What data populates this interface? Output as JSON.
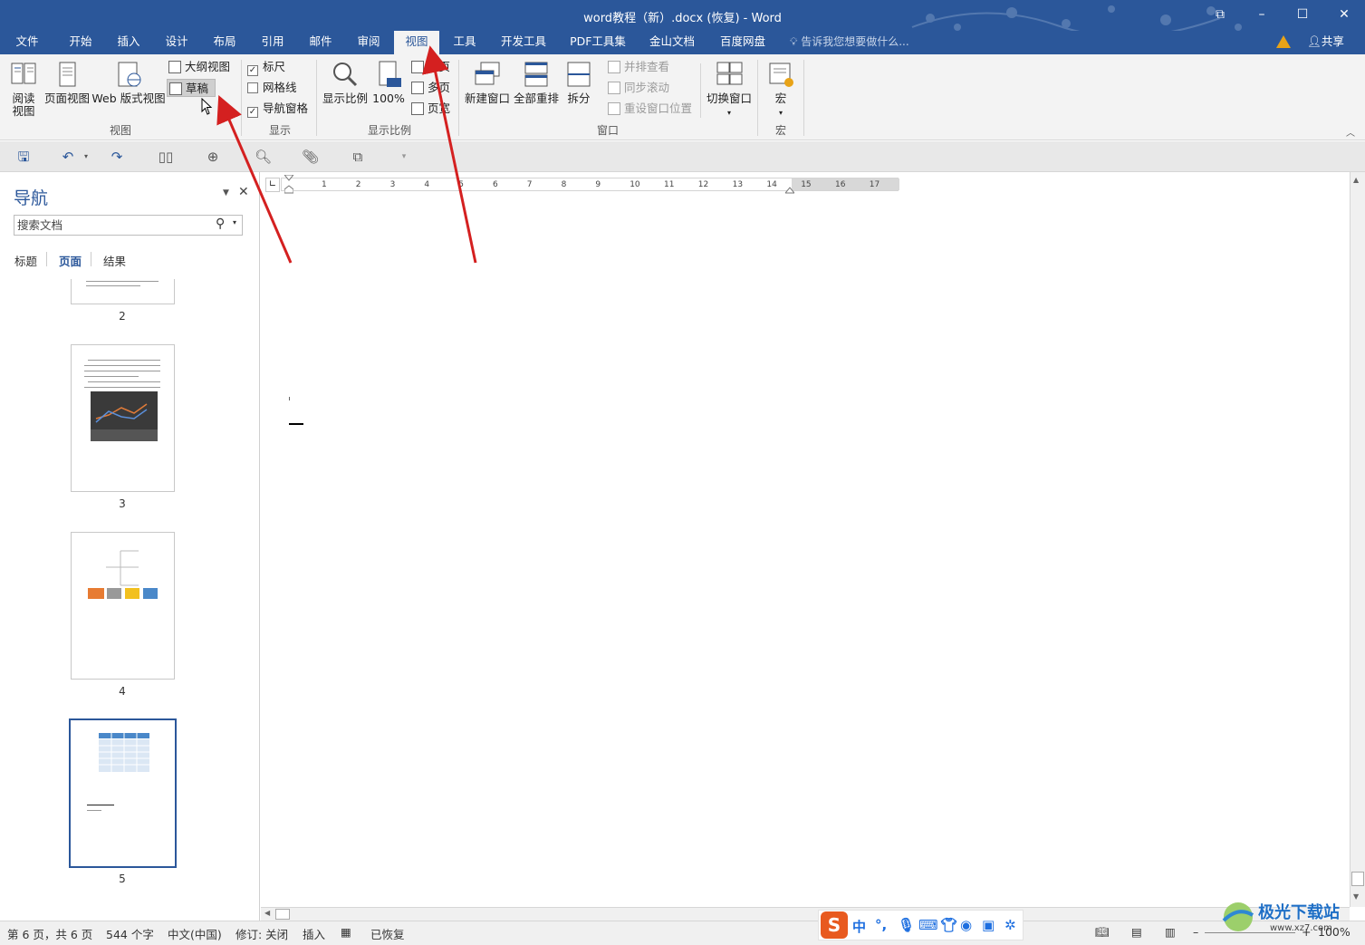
{
  "title_bar": {
    "title": "word教程（新）.docx (恢复) - Word"
  },
  "tabs": [
    "文件",
    "开始",
    "插入",
    "设计",
    "布局",
    "引用",
    "邮件",
    "审阅",
    "视图",
    "工具",
    "开发工具",
    "PDF工具集",
    "金山文档",
    "百度网盘"
  ],
  "tell_me": "告诉我您想要做什么...",
  "share": "共享",
  "ribbon": {
    "view_group": {
      "label": "视图",
      "read_mode": "阅读\n视图",
      "read_mode_1": "阅读",
      "read_mode_2": "视图",
      "print_layout": "页面视图",
      "web_layout": "Web 版式视图",
      "outline": "大纲视图",
      "draft": "草稿"
    },
    "show_group": {
      "label": "显示",
      "ruler": "标尺",
      "gridlines": "网格线",
      "nav_pane": "导航窗格",
      "ruler_checked": true,
      "gridlines_checked": false,
      "nav_pane_checked": true
    },
    "zoom_group": {
      "label": "显示比例",
      "zoom": "显示比例",
      "zoom100": "100%",
      "one_page": "单页",
      "multi_page": "多页",
      "page_width": "页宽"
    },
    "window_group": {
      "label": "窗口",
      "new_window": "新建窗口",
      "arrange_all": "全部重排",
      "split": "拆分",
      "side_by_side": "并排查看",
      "sync_scroll": "同步滚动",
      "reset_pos": "重设窗口位置",
      "switch_window": "切换窗口"
    },
    "macro_group": {
      "label": "宏",
      "macro": "宏"
    }
  },
  "nav": {
    "title": "导航",
    "search_placeholder": "搜索文档",
    "tabs": [
      "标题",
      "页面",
      "结果"
    ],
    "active_tab": "页面",
    "pages": [
      "2",
      "3",
      "4",
      "5"
    ],
    "selected_page": "5"
  },
  "ruler": {
    "ticks": [
      "1",
      "2",
      "3",
      "4",
      "5",
      "6",
      "7",
      "8",
      "9",
      "10",
      "11",
      "12",
      "13",
      "14",
      "15",
      "16",
      "17"
    ]
  },
  "status": {
    "page": "第 6 页，共 6 页",
    "words": "544 个字",
    "lang": "中文(中国)",
    "track": "修订: 关闭",
    "mode": "插入",
    "recovered": "已恢复",
    "zoom": "100%"
  },
  "ime": {
    "lang": "中"
  },
  "watermark": {
    "text": "极光下载站",
    "url": "www.xz7.com"
  },
  "colors": {
    "brand": "#2b579a",
    "arrow": "#d42020"
  }
}
